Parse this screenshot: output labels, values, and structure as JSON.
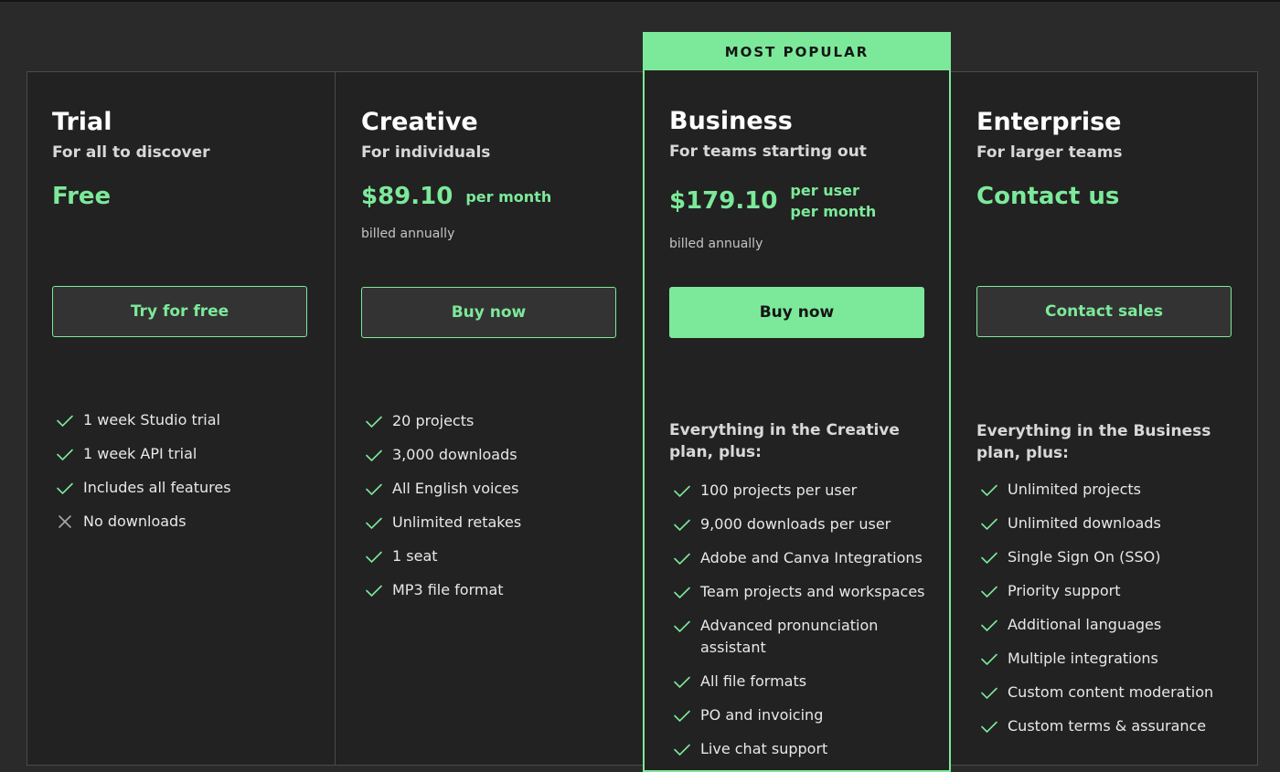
{
  "colors": {
    "accent": "#7ce99a",
    "background": "#2a2a2a",
    "card": "#222222"
  },
  "badge": "MOST POPULAR",
  "plans": [
    {
      "name": "Trial",
      "subtitle": "For all to discover",
      "price": "Free",
      "unit": "",
      "billed": "",
      "button": "Try for free",
      "lead": "",
      "features": [
        {
          "text": "1 week Studio trial",
          "icon": "check-icon"
        },
        {
          "text": "1 week API trial",
          "icon": "check-icon"
        },
        {
          "text": "Includes all features",
          "icon": "check-icon"
        },
        {
          "text": "No downloads",
          "icon": "x-icon"
        }
      ]
    },
    {
      "name": "Creative",
      "subtitle": "For individuals",
      "price": "$89.10",
      "unit": "per month",
      "billed": "billed annually",
      "button": "Buy now",
      "lead": "",
      "features": [
        {
          "text": "20 projects",
          "icon": "check-icon"
        },
        {
          "text": "3,000 downloads",
          "icon": "check-icon"
        },
        {
          "text": "All English voices",
          "icon": "check-icon"
        },
        {
          "text": "Unlimited retakes",
          "icon": "check-icon"
        },
        {
          "text": "1 seat",
          "icon": "check-icon"
        },
        {
          "text": "MP3 file format",
          "icon": "check-icon"
        }
      ]
    },
    {
      "name": "Business",
      "subtitle": "For teams starting out",
      "price": "$179.10",
      "unit": "per user\nper month",
      "billed": "billed annually",
      "button": "Buy now",
      "lead": "Everything in the Creative plan, plus:",
      "features": [
        {
          "text": "100 projects per user",
          "icon": "check-icon"
        },
        {
          "text": "9,000 downloads per user",
          "icon": "check-icon"
        },
        {
          "text": "Adobe and Canva Integrations",
          "icon": "check-icon"
        },
        {
          "text": "Team projects and workspaces",
          "icon": "check-icon"
        },
        {
          "text": "Advanced pronunciation assistant",
          "icon": "check-icon"
        },
        {
          "text": "All file formats",
          "icon": "check-icon"
        },
        {
          "text": "PO and invoicing",
          "icon": "check-icon"
        },
        {
          "text": "Live chat support",
          "icon": "check-icon"
        }
      ]
    },
    {
      "name": "Enterprise",
      "subtitle": "For larger teams",
      "price": "Contact us",
      "unit": "",
      "billed": "",
      "button": "Contact sales",
      "lead": "Everything in the Business plan, plus:",
      "features": [
        {
          "text": "Unlimited projects",
          "icon": "check-icon"
        },
        {
          "text": "Unlimited downloads",
          "icon": "check-icon"
        },
        {
          "text": "Single Sign On (SSO)",
          "icon": "check-icon"
        },
        {
          "text": "Priority support",
          "icon": "check-icon"
        },
        {
          "text": "Additional languages",
          "icon": "check-icon"
        },
        {
          "text": "Multiple integrations",
          "icon": "check-icon"
        },
        {
          "text": "Custom content moderation",
          "icon": "check-icon"
        },
        {
          "text": "Custom terms & assurance",
          "icon": "check-icon"
        }
      ]
    }
  ]
}
